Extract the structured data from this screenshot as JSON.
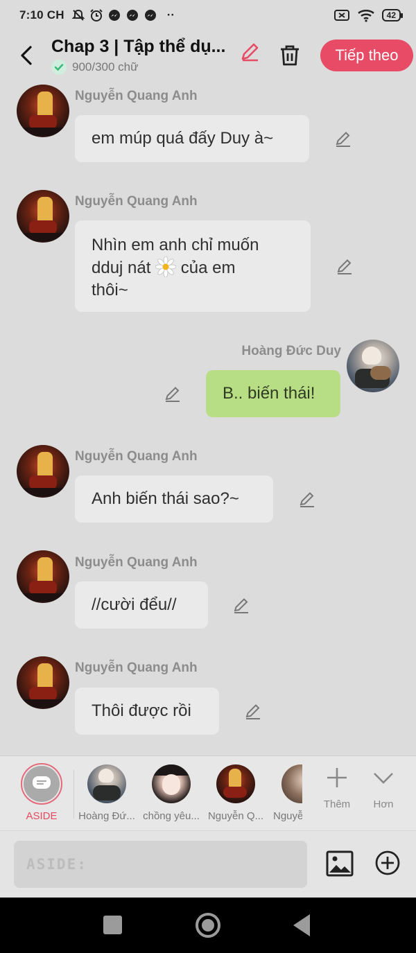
{
  "status_bar": {
    "time": "7:10 CH",
    "battery": "42",
    "more": "··"
  },
  "header": {
    "title": "Chap 3 | Tập thể dụ...",
    "word_count": "900/300 chữ",
    "next_label": "Tiếp theo",
    "accent_color": "#e74b66"
  },
  "messages": [
    {
      "sender": "Nguyễn Quang Anh",
      "text": "em múp quá đấy Duy à~",
      "side": "left"
    },
    {
      "sender": "Nguyễn Quang Anh",
      "text_line1": "Nhìn em anh chỉ muốn",
      "text_line2_pre": "dduj nát",
      "text_line2_post": "của em",
      "text_line3": "thôi~",
      "side": "left"
    },
    {
      "sender": "Hoàng Đức Duy",
      "text": "B.. biến thái!",
      "side": "right"
    },
    {
      "sender": "Nguyễn Quang Anh",
      "text": "Anh biến thái sao?~",
      "side": "left"
    },
    {
      "sender": "Nguyễn Quang Anh",
      "text": "//cười đểu//",
      "side": "left"
    },
    {
      "sender": "Nguyễn Quang Anh",
      "text": "Thôi được rồi",
      "side": "left"
    }
  ],
  "characters": {
    "aside_label": "ASIDE",
    "items": [
      {
        "label": "Hoàng Đứ..."
      },
      {
        "label": "chồng yêu..."
      },
      {
        "label": "Nguyễn Q..."
      },
      {
        "label": "Nguyễ"
      }
    ],
    "add_label": "Thêm",
    "more_label": "Hơn"
  },
  "composer": {
    "placeholder": "ASIDE:"
  }
}
